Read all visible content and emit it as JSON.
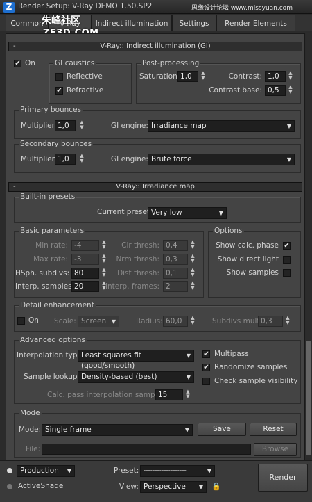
{
  "window": {
    "title": "Render Setup: V-Ray DEMO 1.50.SP2",
    "logo_text": "Z"
  },
  "watermark": {
    "left_cn": "朱峰社区",
    "left_en": "ZF3D.COM",
    "right": "思缘设计论坛 www.missyuan.com"
  },
  "tabs": [
    "Common",
    "V-Ray",
    "Indirect illumination",
    "Settings",
    "Render Elements"
  ],
  "gi_rollout": {
    "sign": "-",
    "title": "V-Ray:: Indirect illumination (GI)",
    "on_label": "On",
    "on_checked": "✔",
    "caustics": {
      "title": "GI caustics",
      "reflective": "Reflective",
      "refractive": "Refractive",
      "refractive_check": "✔"
    },
    "post": {
      "title": "Post-processing",
      "saturation_label": "Saturation:",
      "saturation": "1,0",
      "contrast_label": "Contrast:",
      "contrast": "1,0",
      "contrast_base_label": "Contrast base:",
      "contrast_base": "0,5"
    },
    "primary": {
      "title": "Primary bounces",
      "multiplier_label": "Multiplier:",
      "multiplier": "1,0",
      "engine_label": "GI engine:",
      "engine": "Irradiance map"
    },
    "secondary": {
      "title": "Secondary bounces",
      "multiplier_label": "Multiplier:",
      "multiplier": "1,0",
      "engine_label": "GI engine:",
      "engine": "Brute force"
    }
  },
  "irr_rollout": {
    "sign": "-",
    "title": "V-Ray:: Irradiance map",
    "presets": {
      "title": "Built-in presets",
      "current_label": "Current preset:",
      "current": "Very low"
    },
    "basic": {
      "title": "Basic parameters",
      "min_rate_label": "Min rate:",
      "min_rate": "-4",
      "max_rate_label": "Max rate:",
      "max_rate": "-3",
      "hsph_label": "HSph. subdivs:",
      "hsph": "80",
      "interp_label": "Interp. samples:",
      "interp": "20",
      "clr_label": "Clr thresh:",
      "clr": "0,4",
      "nrm_label": "Nrm thresh:",
      "nrm": "0,3",
      "dist_label": "Dist thresh:",
      "dist": "0,1",
      "frames_label": "Interp. frames:",
      "frames": "2"
    },
    "options": {
      "title": "Options",
      "show_calc": "Show calc. phase",
      "show_calc_check": "✔",
      "show_direct": "Show direct light",
      "show_samples": "Show samples"
    },
    "detail": {
      "title": "Detail enhancement",
      "on_label": "On",
      "scale_label": "Scale:",
      "scale": "Screen",
      "radius_label": "Radius:",
      "radius": "60,0",
      "subdivs_label": "Subdivs mult.",
      "subdivs": "0,3"
    },
    "advanced": {
      "title": "Advanced options",
      "interp_type_label": "Interpolation type:",
      "interp_type": "Least squares fit (good/smooth)",
      "lookup_label": "Sample lookup:",
      "lookup": "Density-based (best)",
      "calc_label": "Calc. pass interpolation samples:",
      "calc": "15",
      "multipass": "Multipass",
      "multipass_check": "✔",
      "randomize": "Randomize samples",
      "randomize_check": "✔",
      "check_vis": "Check sample visibility"
    },
    "mode": {
      "title": "Mode",
      "mode_label": "Mode:",
      "mode": "Single frame",
      "save": "Save",
      "reset": "Reset",
      "file_label": "File:",
      "browse": "Browse"
    }
  },
  "bottom": {
    "production": "Production",
    "activeshade": "ActiveShade",
    "preset_label": "Preset:",
    "preset": "-------------------",
    "view_label": "View:",
    "view": "Perspective",
    "render": "Render"
  }
}
